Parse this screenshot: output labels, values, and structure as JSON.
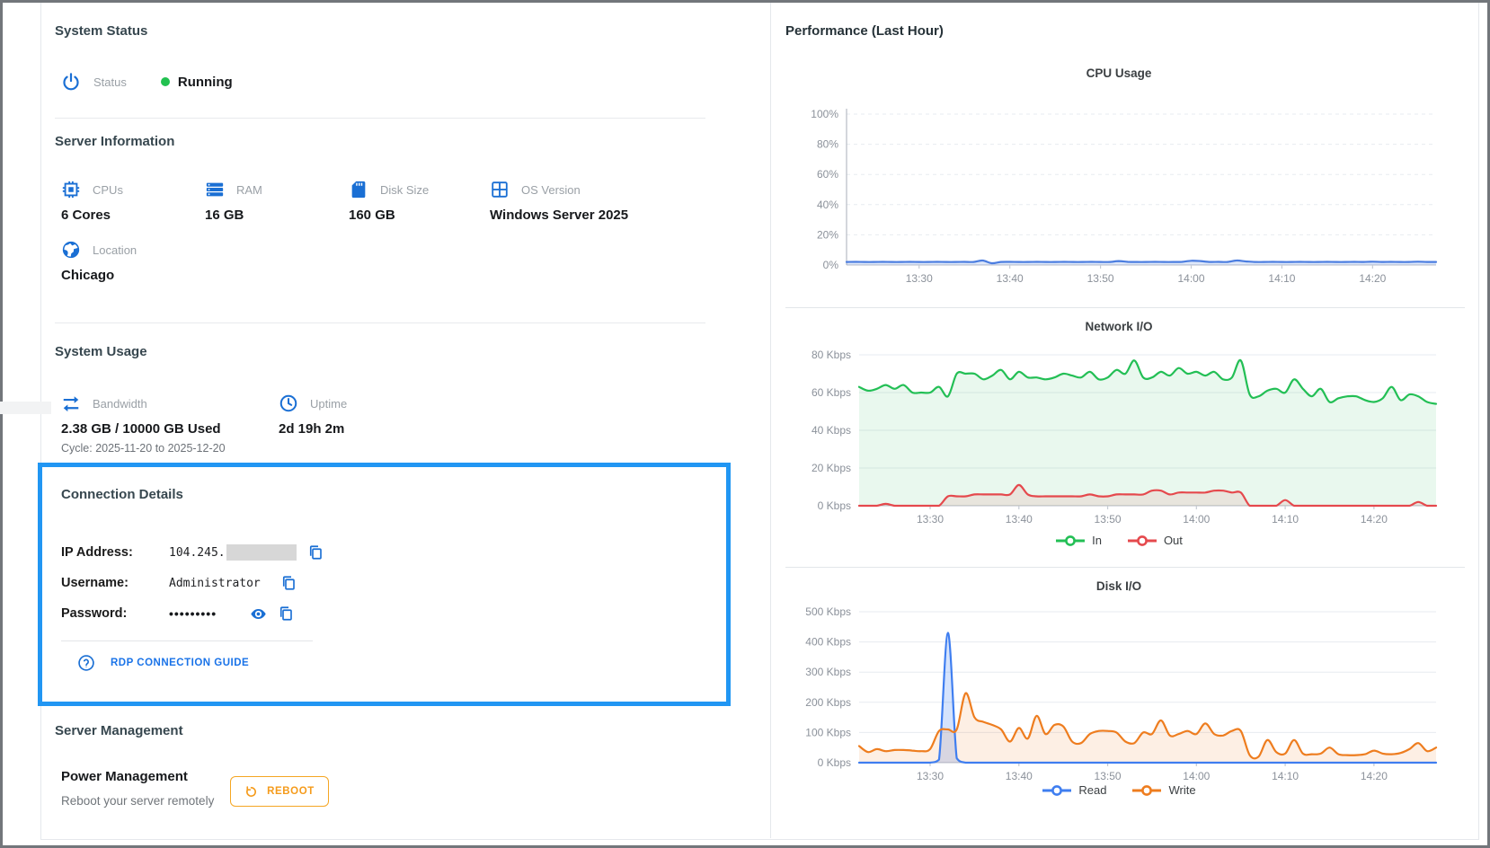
{
  "colors": {
    "accent_blue": "#1a6fd4",
    "highlight_border": "#2196f3",
    "status_green": "#22c150",
    "warning_orange": "#f59b1b",
    "cpu_line": "#4b7de0",
    "net_in": "#23bf55",
    "net_out": "#e5494d",
    "disk_read": "#3f7ef0",
    "disk_write": "#ee7d1f"
  },
  "left_panel": {
    "system_status": {
      "title": "System Status",
      "status_label": "Status",
      "status_value": "Running",
      "status_icon": "power-icon"
    },
    "server_information": {
      "title": "Server Information",
      "items": [
        {
          "icon": "cpu-chip-icon",
          "label": "CPUs",
          "value": "6 Cores"
        },
        {
          "icon": "ram-icon",
          "label": "RAM",
          "value": "16 GB"
        },
        {
          "icon": "disk-icon",
          "label": "Disk Size",
          "value": "160 GB"
        },
        {
          "icon": "os-window-icon",
          "label": "OS Version",
          "value": "Windows Server 2025"
        },
        {
          "icon": "globe-icon",
          "label": "Location",
          "value": "Chicago"
        }
      ]
    },
    "system_usage": {
      "title": "System Usage",
      "bandwidth": {
        "icon": "swap-arrows-icon",
        "label": "Bandwidth",
        "value": "2.38 GB / 10000 GB Used",
        "cycle": "Cycle: 2025-11-20 to 2025-12-20"
      },
      "uptime": {
        "icon": "clock-icon",
        "label": "Uptime",
        "value": "2d 19h 2m"
      }
    },
    "connection_details": {
      "title": "Connection Details",
      "ip": {
        "label": "IP Address:",
        "value": "104.245.",
        "redacted": true
      },
      "username": {
        "label": "Username:",
        "value": "Administrator"
      },
      "password": {
        "label": "Password:",
        "value": "•••••••••"
      },
      "rdp_link": "RDP CONNECTION GUIDE"
    },
    "server_management": {
      "title": "Server Management",
      "power": {
        "title": "Power Management",
        "subtitle": "Reboot your server remotely",
        "button": "REBOOT"
      }
    }
  },
  "right_panel": {
    "title": "Performance (Last Hour)"
  },
  "chart_data": [
    {
      "id": "cpu",
      "type": "line",
      "title": "CPU Usage",
      "ylabel": "",
      "y_max": 100,
      "y_ticks": [
        0,
        20,
        40,
        60,
        80,
        100
      ],
      "y_suffix": "%",
      "grid": "dashed",
      "left_axis": true,
      "legend": false,
      "x_start_min": 802,
      "x_end_min": 867,
      "x_ticks": [
        {
          "m": 810,
          "label": "13:30"
        },
        {
          "m": 820,
          "label": "13:40"
        },
        {
          "m": 830,
          "label": "13:50"
        },
        {
          "m": 840,
          "label": "14:00"
        },
        {
          "m": 850,
          "label": "14:10"
        },
        {
          "m": 860,
          "label": "14:20"
        }
      ],
      "series": [
        {
          "name": "CPU",
          "color": "#4b7de0",
          "fill": "rgba(75,125,224,0.18)",
          "values": [
            2.0,
            2.1,
            2.0,
            2.0,
            2.1,
            2.0,
            2.0,
            2.1,
            2.0,
            2.0,
            2.1,
            2.0,
            2.0,
            2.1,
            2.0,
            3.0,
            1.2,
            2.0,
            2.1,
            2.0,
            2.0,
            2.1,
            2.0,
            2.0,
            2.1,
            2.0,
            2.0,
            2.1,
            2.0,
            2.0,
            2.6,
            2.1,
            2.0,
            2.0,
            2.1,
            2.0,
            2.0,
            2.1,
            2.8,
            2.6,
            2.0,
            2.1,
            2.0,
            3.0,
            2.4,
            2.0,
            2.0,
            2.1,
            2.0,
            2.0,
            2.1,
            2.0,
            2.0,
            2.1,
            2.0,
            2.0,
            2.1,
            2.0,
            2.2,
            2.0,
            2.1,
            2.0,
            2.0,
            2.2,
            2.0,
            2.0
          ]
        }
      ]
    },
    {
      "id": "network",
      "type": "line",
      "title": "Network I/O",
      "y_max": 80,
      "y_ticks": [
        0,
        20,
        40,
        60,
        80
      ],
      "y_suffix": " Kbps",
      "grid": "solid",
      "left_axis": false,
      "legend": true,
      "x_start_min": 802,
      "x_end_min": 867,
      "x_ticks": [
        {
          "m": 810,
          "label": "13:30"
        },
        {
          "m": 820,
          "label": "13:40"
        },
        {
          "m": 830,
          "label": "13:50"
        },
        {
          "m": 840,
          "label": "14:00"
        },
        {
          "m": 850,
          "label": "14:10"
        },
        {
          "m": 860,
          "label": "14:20"
        }
      ],
      "series": [
        {
          "name": "In",
          "color": "#23bf55",
          "fill": "rgba(35,191,85,0.10)",
          "values": [
            63,
            61,
            62,
            64,
            62,
            64,
            60,
            60,
            60,
            63,
            58,
            70,
            70,
            70,
            67,
            69,
            72,
            67,
            71,
            68,
            68,
            67,
            68,
            70,
            69,
            68,
            71,
            67,
            68,
            72,
            70,
            77,
            68,
            68,
            71,
            69,
            73,
            70,
            71,
            69,
            71,
            67,
            68,
            77,
            59,
            58,
            61,
            62,
            60,
            67,
            62,
            58,
            62,
            55,
            57,
            58,
            58,
            56,
            55,
            57,
            63,
            56,
            59,
            58,
            55,
            54
          ]
        },
        {
          "name": "Out",
          "color": "#e5494d",
          "fill": "rgba(229,73,77,0.10)",
          "values": [
            0,
            0,
            0,
            1,
            0,
            0,
            0,
            0,
            0,
            0,
            5,
            5,
            5,
            6,
            6,
            6,
            6,
            6,
            11,
            6,
            5,
            5,
            5,
            5,
            5,
            5,
            6,
            5,
            5,
            6,
            6,
            6,
            6,
            8,
            8,
            6,
            7,
            7,
            7,
            7,
            8,
            8,
            7,
            7,
            0,
            0,
            0,
            0,
            3,
            0,
            0,
            0,
            0,
            0,
            0,
            0,
            0,
            0,
            0,
            0,
            0,
            0,
            0,
            2,
            0,
            0
          ]
        }
      ]
    },
    {
      "id": "disk",
      "type": "line",
      "title": "Disk I/O",
      "y_max": 500,
      "y_ticks": [
        0,
        100,
        200,
        300,
        400,
        500
      ],
      "y_suffix": " Kbps",
      "grid": "solid",
      "left_axis": false,
      "legend": true,
      "x_start_min": 802,
      "x_end_min": 867,
      "x_ticks": [
        {
          "m": 810,
          "label": "13:30"
        },
        {
          "m": 820,
          "label": "13:40"
        },
        {
          "m": 830,
          "label": "13:50"
        },
        {
          "m": 840,
          "label": "14:00"
        },
        {
          "m": 850,
          "label": "14:10"
        },
        {
          "m": 860,
          "label": "14:20"
        }
      ],
      "series": [
        {
          "name": "Read",
          "color": "#3f7ef0",
          "fill": "rgba(63,126,240,0.22)",
          "values": [
            0,
            0,
            0,
            0,
            0,
            0,
            0,
            0,
            0,
            10,
            430,
            15,
            0,
            0,
            0,
            0,
            0,
            0,
            0,
            0,
            0,
            0,
            0,
            0,
            0,
            0,
            0,
            0,
            0,
            0,
            0,
            0,
            0,
            0,
            0,
            0,
            0,
            0,
            0,
            0,
            0,
            0,
            0,
            0,
            0,
            0,
            0,
            0,
            0,
            0,
            0,
            0,
            0,
            0,
            0,
            0,
            0,
            0,
            0,
            0,
            0,
            0,
            0,
            0,
            0,
            0
          ]
        },
        {
          "name": "Write",
          "color": "#ee7d1f",
          "fill": "rgba(238,125,31,0.12)",
          "values": [
            55,
            35,
            45,
            38,
            42,
            42,
            40,
            38,
            45,
            105,
            110,
            110,
            230,
            150,
            135,
            125,
            110,
            70,
            115,
            80,
            155,
            95,
            125,
            120,
            70,
            65,
            95,
            105,
            105,
            100,
            70,
            65,
            100,
            95,
            140,
            90,
            95,
            105,
            95,
            130,
            95,
            90,
            105,
            105,
            25,
            20,
            75,
            35,
            30,
            75,
            30,
            28,
            30,
            50,
            28,
            25,
            25,
            28,
            40,
            30,
            28,
            32,
            45,
            65,
            38,
            50
          ]
        }
      ]
    }
  ]
}
